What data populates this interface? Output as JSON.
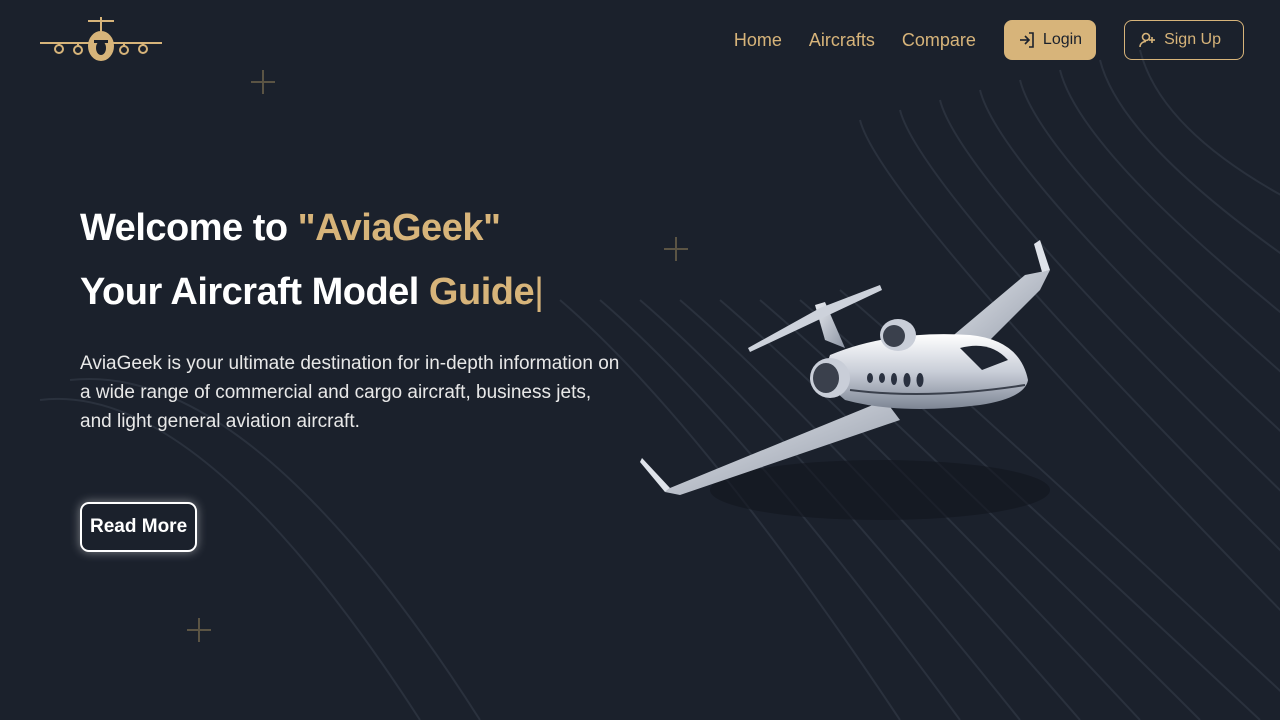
{
  "nav": {
    "links": [
      "Home",
      "Aircrafts",
      "Compare"
    ],
    "login_label": "Login",
    "signup_label": "Sign Up"
  },
  "hero": {
    "title_prefix": "Welcome to ",
    "title_brand": "\"AviaGeek\"",
    "subtitle_prefix": "Your Aircraft Model ",
    "subtitle_highlight": "Guide",
    "caret": "|",
    "description": "AviaGeek is your ultimate destination for in-depth information on a wide range of commercial and cargo aircraft, business jets, and light general aviation aircraft.",
    "cta_label": "Read More"
  },
  "icons": {
    "logo": "airplane-logo-icon",
    "login": "login-arrow-icon",
    "signup": "user-plus-icon",
    "decor": "plus-icon"
  },
  "colors": {
    "background": "#1b212c",
    "accent": "#d7b47a",
    "text": "#ffffff"
  }
}
